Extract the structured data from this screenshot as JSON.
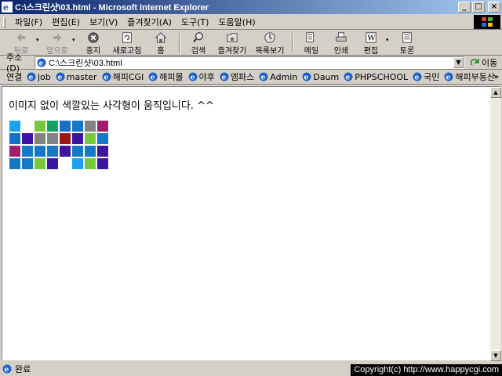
{
  "window": {
    "title": "C:\\스크린샷\\03.html - Microsoft Internet Explorer",
    "minimize": "_",
    "maximize": "□",
    "close": "×"
  },
  "menu": [
    "파일(F)",
    "편집(E)",
    "보기(V)",
    "즐겨찾기(A)",
    "도구(T)",
    "도움말(H)"
  ],
  "toolbar": {
    "back": "뒤로",
    "forward": "앞으로",
    "stop": "중지",
    "refresh": "새로고침",
    "home": "홈",
    "search": "검색",
    "favorites": "즐겨찾기",
    "history": "목록보기",
    "mail": "메일",
    "print": "인쇄",
    "edit": "편집",
    "discuss": "토론"
  },
  "address": {
    "label": "주소(D)",
    "value": "C:\\스크린샷\\03.html",
    "go": "이동"
  },
  "links": {
    "label": "연결",
    "items": [
      "job",
      "master",
      "해피CGI",
      "해피몰",
      "야후",
      "엠파스",
      "Admin",
      "Daum",
      "PHPSCHOOL",
      "국민",
      "해피부동산"
    ],
    "more": "»"
  },
  "content": {
    "text": "이미지 없이 색깔있는 사각형이 움직입니다. ^^",
    "grid_colors": [
      [
        "#1ea0f0",
        "#ffffff",
        "#78c83c",
        "#14a064",
        "#1470c8",
        "#1478c8",
        "#828282",
        "#a01e6e"
      ],
      [
        "#1470c8",
        "#3c14a0",
        "#828282",
        "#828282",
        "#a01414",
        "#3c14a0",
        "#78c83c",
        "#1478c8"
      ],
      [
        "#a01e6e",
        "#1478c8",
        "#1478c8",
        "#1478c8",
        "#3c14a0",
        "#1478c8",
        "#1478c8",
        "#3c14a0"
      ],
      [
        "#1478c8",
        "#1478c8",
        "#78c83c",
        "#3c14a0",
        "#ffffff",
        "#1ea0f0",
        "#78c83c",
        "#3c14a0"
      ]
    ]
  },
  "status": {
    "text": "완료",
    "copyright": "Copyright(c) http://www.happycgi.com"
  }
}
